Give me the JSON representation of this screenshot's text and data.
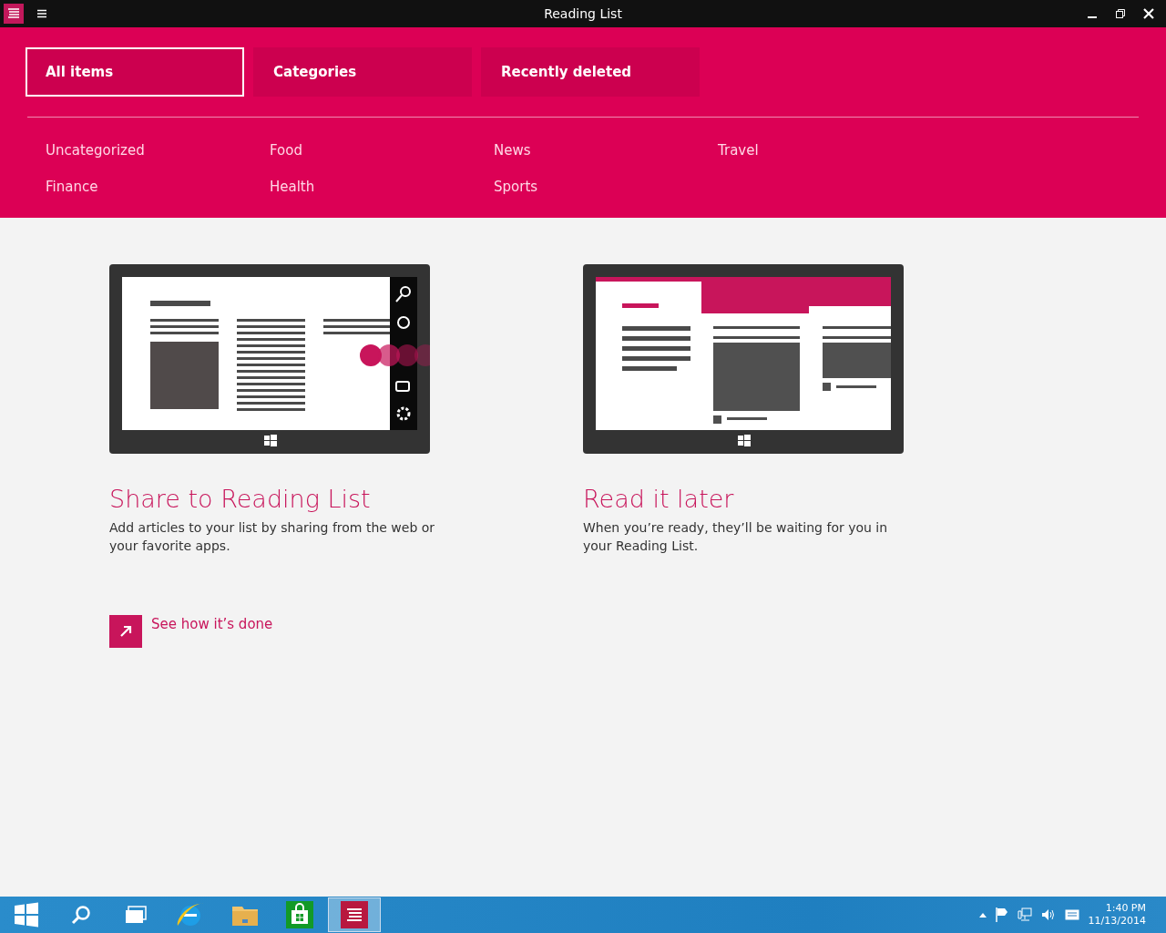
{
  "window": {
    "title": "Reading List"
  },
  "tabs": [
    {
      "label": "All items",
      "selected": true
    },
    {
      "label": "Categories",
      "selected": false
    },
    {
      "label": "Recently deleted",
      "selected": false
    }
  ],
  "categories": [
    "Uncategorized",
    "Food",
    "News",
    "Travel",
    "Finance",
    "Health",
    "Sports"
  ],
  "cards": [
    {
      "kind": "share",
      "title": "Share to Reading List",
      "description": "Add articles to your list by sharing from the web or your favorite apps."
    },
    {
      "kind": "later",
      "title": "Read it later",
      "description": "When you’re ready, they’ll be waiting for you in your Reading List."
    }
  ],
  "link": {
    "label": "See how it’s done"
  },
  "taskbar": {
    "apps": [
      {
        "kind": "start",
        "selected": false
      },
      {
        "kind": "search",
        "selected": false
      },
      {
        "kind": "taskview",
        "selected": false
      },
      {
        "kind": "browser",
        "selected": false
      },
      {
        "kind": "folder",
        "selected": false
      },
      {
        "kind": "store",
        "selected": false
      },
      {
        "kind": "reading",
        "selected": true
      }
    ],
    "time": "1:40 PM",
    "date": "11/13/2014"
  }
}
